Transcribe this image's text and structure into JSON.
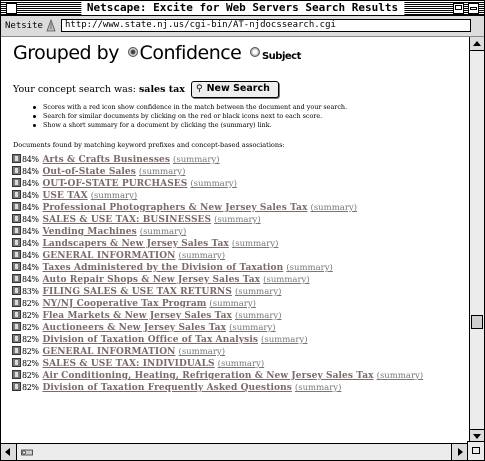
{
  "window": {
    "title": "Netscape: Excite for Web Servers Search Results"
  },
  "location": {
    "label": "Netsite :",
    "url": "http://www.state.nj.us/cgi-bin/AT-njdocssearch.cgi"
  },
  "heading": {
    "grouped_by": "Grouped by",
    "confidence": "Confidence",
    "subject": "Subject"
  },
  "concept": {
    "prefix": "Your concept search was:",
    "term": "sales tax",
    "new_search_label": "New Search"
  },
  "help_bullets": [
    "Scores with a red icon show confidence in the match between the document and your search.",
    "Search for similar documents by clicking on the red or black icons next to each score.",
    "Show a short summary for a document by clicking the (summary) link."
  ],
  "found_text": "Documents found by matching keyword prefixes and concept-based associations:",
  "summary_label": "(summary)",
  "results": [
    {
      "score": "84%",
      "title": "Arts & Crafts Businesses"
    },
    {
      "score": "84%",
      "title": "Out-of-State Sales"
    },
    {
      "score": "84%",
      "title": "OUT-OF-STATE PURCHASES"
    },
    {
      "score": "84%",
      "title": "USE TAX"
    },
    {
      "score": "84%",
      "title": "Professional Photographers & New Jersey Sales Tax"
    },
    {
      "score": "84%",
      "title": "SALES & USE TAX: BUSINESSES"
    },
    {
      "score": "84%",
      "title": "Vending Machines"
    },
    {
      "score": "84%",
      "title": "Landscapers & New Jersey Sales Tax"
    },
    {
      "score": "84%",
      "title": "GENERAL INFORMATION"
    },
    {
      "score": "84%",
      "title": "Taxes Administered by the Division of Taxation"
    },
    {
      "score": "84%",
      "title": "Auto Repair Shops & New Jersey Sales Tax"
    },
    {
      "score": "83%",
      "title": "FILING SALES & USE TAX RETURNS"
    },
    {
      "score": "82%",
      "title": "NY/NJ Cooperative Tax Program"
    },
    {
      "score": "82%",
      "title": "Flea Markets & New Jersey Sales Tax"
    },
    {
      "score": "82%",
      "title": "Auctioneers & New Jersey Sales Tax"
    },
    {
      "score": "82%",
      "title": "Division of Taxation Office of Tax Analysis"
    },
    {
      "score": "82%",
      "title": "GENERAL INFORMATION"
    },
    {
      "score": "82%",
      "title": "SALES & USE TAX: INDIVIDUALS"
    },
    {
      "score": "82%",
      "title": "Air Conditioning, Heating, Refrigeration & New Jersey Sales Tax"
    },
    {
      "score": "82%",
      "title": "Division of Taxation Frequently Asked Questions"
    }
  ]
}
